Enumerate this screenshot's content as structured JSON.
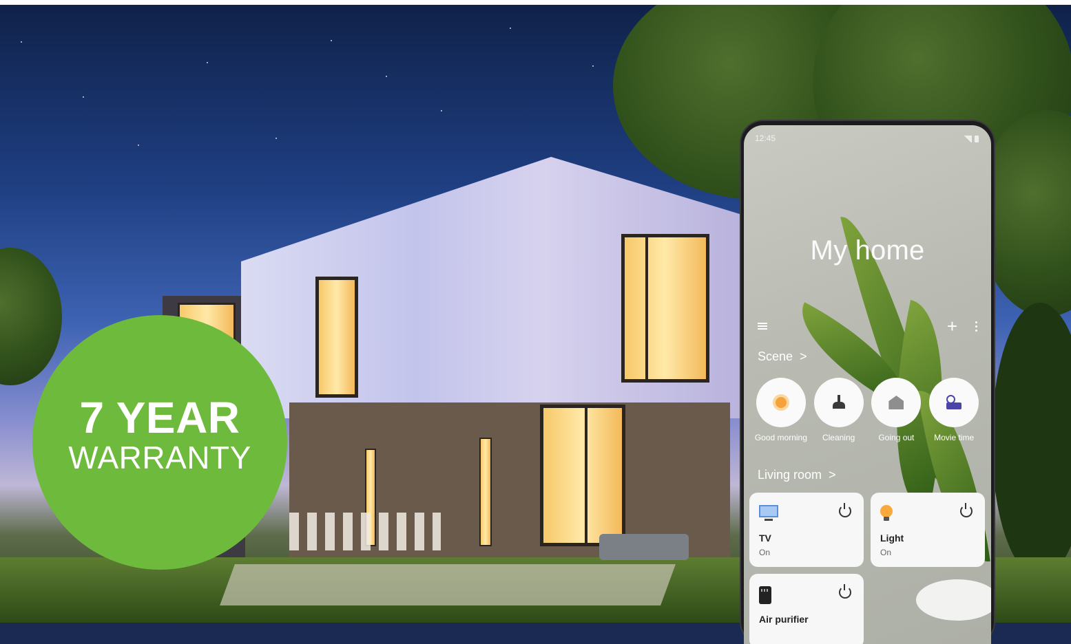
{
  "badge": {
    "title": "7 YEAR",
    "subtitle": "WARRANTY",
    "color": "#6dba3c"
  },
  "phone": {
    "status_time": "12:45",
    "home_title": "My home",
    "toolbar": {
      "menu_icon": "hamburger-icon",
      "add_icon": "plus-icon",
      "more_icon": "more-vertical-icon"
    },
    "scene_section": {
      "title": "Scene",
      "chevron": ">"
    },
    "scenes": [
      {
        "label": "Good morning",
        "icon": "sun-icon"
      },
      {
        "label": "Cleaning",
        "icon": "broom-icon"
      },
      {
        "label": "Going out",
        "icon": "house-icon"
      },
      {
        "label": "Movie time",
        "icon": "camera-icon"
      }
    ],
    "room_section": {
      "title": "Living room",
      "chevron": ">"
    },
    "devices": [
      {
        "name": "TV",
        "status": "On",
        "icon": "tv-icon"
      },
      {
        "name": "Light",
        "status": "On",
        "icon": "bulb-icon"
      },
      {
        "name": "Air purifier",
        "status": "",
        "icon": "air-purifier-icon"
      }
    ]
  }
}
